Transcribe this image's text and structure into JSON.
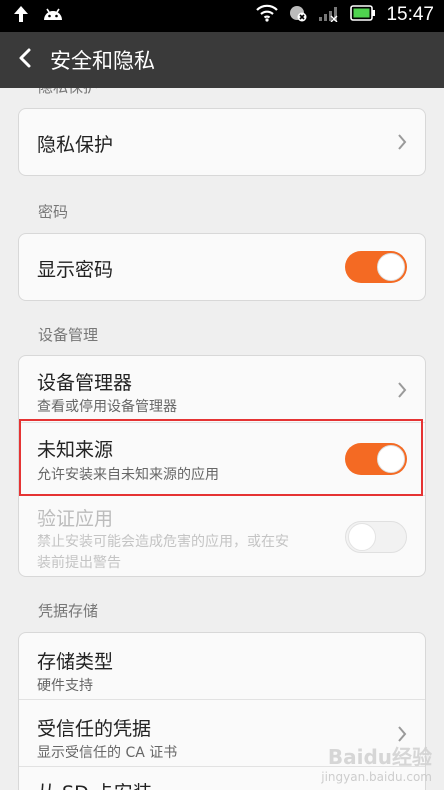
{
  "status_bar": {
    "time": "15:47",
    "icons": [
      "upload-arrow-icon",
      "android-icon",
      "wifi-icon",
      "alarm-icon",
      "signal-icon",
      "battery-icon"
    ]
  },
  "header": {
    "title": "安全和隐私"
  },
  "sections": {
    "privacy": {
      "label_partial": "隐私保护",
      "item_label": "隐私保护"
    },
    "password": {
      "label": "密码",
      "show_password": {
        "label": "显示密码",
        "on": true
      }
    },
    "device_admin": {
      "label": "设备管理",
      "device_managers": {
        "label": "设备管理器",
        "sub": "查看或停用设备管理器"
      },
      "unknown_sources": {
        "label": "未知来源",
        "sub": "允许安装来自未知来源的应用",
        "on": true
      },
      "verify_apps": {
        "label": "验证应用",
        "sub_line1": "禁止安装可能会造成危害的应用，或在安",
        "sub_line2": "装前提出警告",
        "on": false
      }
    },
    "credentials": {
      "label": "凭据存储",
      "storage_type": {
        "label": "存储类型",
        "sub": "硬件支持"
      },
      "trusted": {
        "label": "受信任的凭据",
        "sub": "显示受信任的 CA 证书"
      },
      "install_from_sd_partial": "从 SD 卡安装"
    }
  },
  "watermark": {
    "brand": "Baidu经验",
    "url": "jingyan.baidu.com"
  },
  "colors": {
    "accent": "#f46a23",
    "highlight": "#e53333",
    "title_bar": "#3a3a3a"
  }
}
